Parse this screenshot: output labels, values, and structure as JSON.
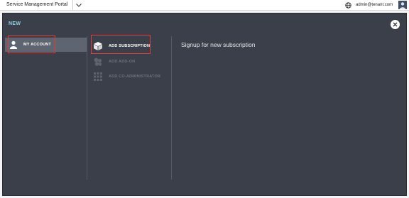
{
  "topbar": {
    "portal_title": "Service Management Portal",
    "user_email": "admin@tenant.com",
    "dropdown_icon": "chevron-down-icon",
    "globe_icon": "globe-icon",
    "avatar_icon": "user-avatar-icon"
  },
  "panel": {
    "new_label": "NEW",
    "close_icon": "close-icon",
    "categories": [
      {
        "label": "MY ACCOUNT",
        "icon": "person-icon",
        "selected": true
      }
    ],
    "items": [
      {
        "label": "ADD SUBSCRIPTION",
        "icon": "box-icon",
        "enabled": true
      },
      {
        "label": "ADD ADD-ON",
        "icon": "addon-icon",
        "enabled": false
      },
      {
        "label": "ADD CO-ADMINISTRATOR",
        "icon": "grid-icon",
        "enabled": false
      }
    ],
    "detail_title": "Signup for new subscription"
  },
  "colors": {
    "panel_bg": "#3a3f4a",
    "selected_bg": "#5f6570",
    "accent": "#8fd0ea",
    "highlight": "#e43a3a",
    "disabled_text": "#6c727d"
  }
}
